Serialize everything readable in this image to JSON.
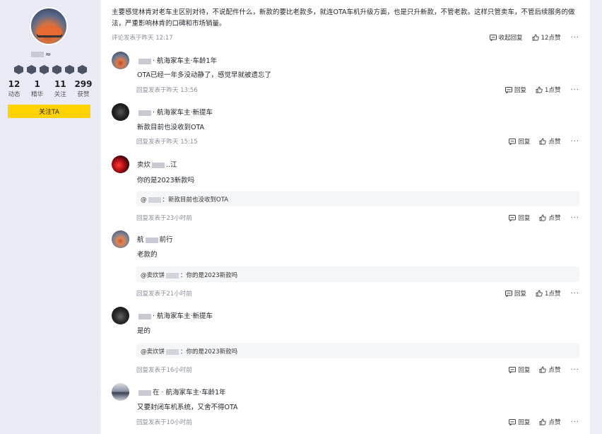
{
  "profile": {
    "nickname_visible": "≈",
    "stats": [
      {
        "num": "12",
        "label": "动态"
      },
      {
        "num": "1",
        "label": "精华"
      },
      {
        "num": "11",
        "label": "关注"
      },
      {
        "num": "299",
        "label": "获赞"
      }
    ],
    "follow_label": "关注TA"
  },
  "post": {
    "text": "主要感觉林肯对老车主区别对待，不说配件什么，新款的要比老款多，就连OTA车机升级方面，也是只升新款，不管老款。这样只管卖车，不管后续服务的做法，严重影响林肯的口碑和市场销量。",
    "time": "评论发表于昨天 12:17",
    "reply_label": "收起回复",
    "like_label": "12点赞"
  },
  "comments": [
    {
      "name_prefix": "",
      "name_suffix": "· 航海家车主·车龄1年",
      "text": "OTA已经一年多没动静了，感觉早就被遗忘了",
      "time": "回复发表于昨天 13:56",
      "reply_label": "回复",
      "like_label": "1点赞"
    },
    {
      "name_prefix": "",
      "name_suffix": "· 航海家车主·新提车",
      "text": "新款目前也没收到OTA",
      "time": "回复发表于昨天 15:15",
      "reply_label": "回复",
      "like_label": "点赞"
    },
    {
      "name_prefix": "卖炊",
      "name_suffix": "..江",
      "text": "你的是2023新款吗",
      "quote_prefix": "@",
      "quote_suffix": "：新款目前也没收到OTA",
      "time": "回复发表于23小时前",
      "reply_label": "回复",
      "like_label": "点赞"
    },
    {
      "name_prefix": "航",
      "name_suffix": "前行",
      "text": "老款的",
      "quote_prefix": "@卖炊饼",
      "quote_suffix": "：你的是2023新款吗",
      "time": "回复发表于21小时前",
      "reply_label": "回复",
      "like_label": "1点赞"
    },
    {
      "name_prefix": "",
      "name_suffix": "· 航海家车主·新提车",
      "text": "是的",
      "quote_prefix": "@卖炊饼",
      "quote_suffix": "：你的是2023新款吗",
      "time": "回复发表于16小时前",
      "reply_label": "回复",
      "like_label": "点赞"
    },
    {
      "name_prefix": "",
      "name_suffix": "在 · 航海家车主·车龄1年",
      "text": "又要封闭车机系统，又舍不得OTA",
      "time": "回复发表于10小时前",
      "reply_label": "回复",
      "like_label": "点赞"
    }
  ]
}
